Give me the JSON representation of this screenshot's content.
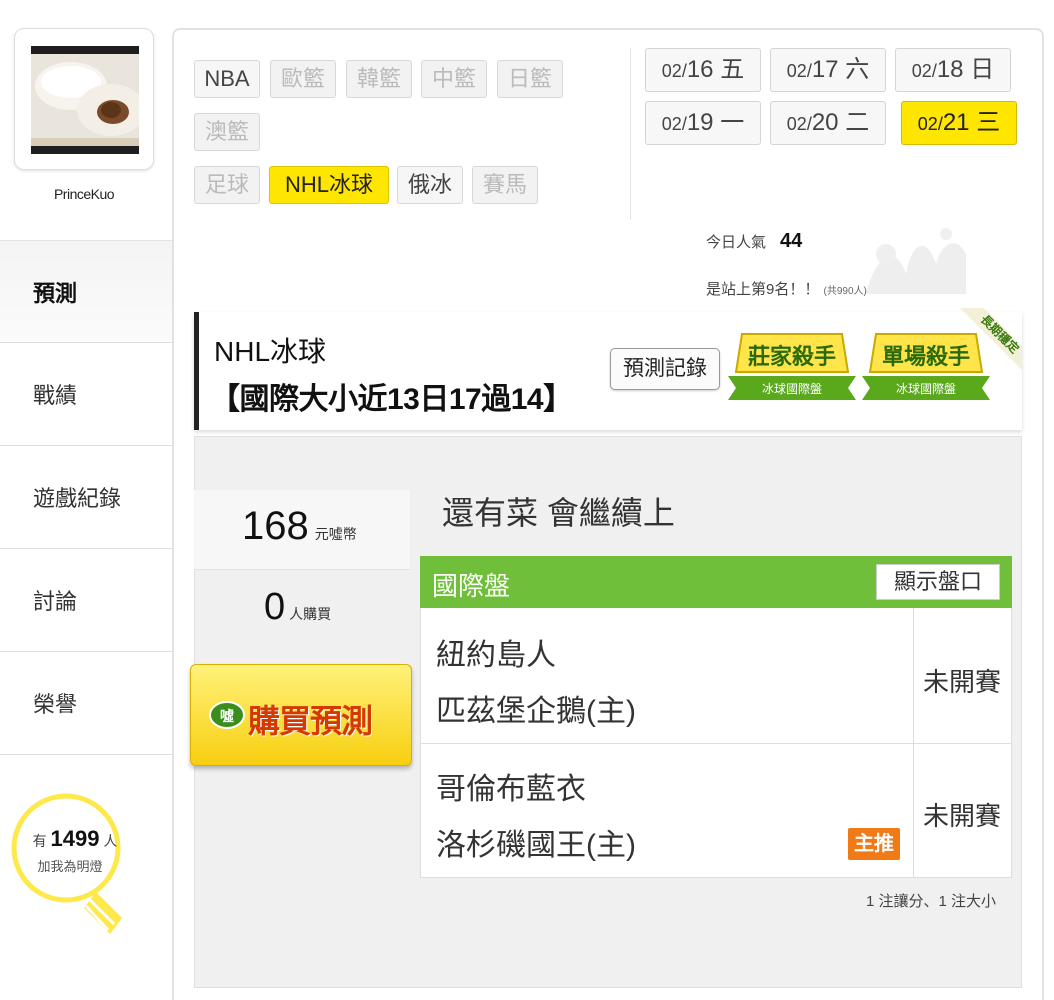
{
  "sidebar": {
    "username": "PrinceKuo",
    "items": [
      {
        "label": "預測",
        "active": true
      },
      {
        "label": "戰績"
      },
      {
        "label": "遊戲紀錄"
      },
      {
        "label": "討論"
      },
      {
        "label": "榮譽"
      }
    ],
    "fans": {
      "prefix": "有",
      "count": "1499",
      "suffix": "人",
      "label": "加我為明燈"
    }
  },
  "categories": [
    {
      "label": "NBA",
      "state": "enabled"
    },
    {
      "label": "歐籃",
      "state": "disabled"
    },
    {
      "label": "韓籃",
      "state": "disabled"
    },
    {
      "label": "中籃",
      "state": "disabled"
    },
    {
      "label": "日籃",
      "state": "disabled"
    },
    {
      "label": "澳籃",
      "state": "disabled"
    },
    {
      "label": "足球",
      "state": "disabled"
    },
    {
      "label": "NHL冰球",
      "state": "active"
    },
    {
      "label": "俄冰",
      "state": "enabled"
    },
    {
      "label": "賽馬",
      "state": "disabled"
    }
  ],
  "dates": [
    {
      "prefix": "02/",
      "day": "16",
      "weekday": "五"
    },
    {
      "prefix": "02/",
      "day": "17",
      "weekday": "六"
    },
    {
      "prefix": "02/",
      "day": "18",
      "weekday": "日"
    },
    {
      "prefix": "02/",
      "day": "19",
      "weekday": "一"
    },
    {
      "prefix": "02/",
      "day": "20",
      "weekday": "二"
    },
    {
      "prefix": "02/",
      "day": "21",
      "weekday": "三",
      "active": true
    }
  ],
  "stats": {
    "popularity_label": "今日人氣",
    "popularity_value": "44",
    "rank_text": "是站上第9名！！",
    "rank_total": "(共990人)"
  },
  "banner": {
    "title": "NHL冰球",
    "subtitle": "【國際大小近13日17過14】",
    "record_button": "預測記錄",
    "badges": [
      {
        "title": "莊家殺手",
        "sub": "冰球國際盤"
      },
      {
        "title": "單場殺手",
        "sub": "冰球國際盤"
      }
    ],
    "ribbon": "長期穩定"
  },
  "prediction": {
    "price_value": "168",
    "price_unit": "元噓幣",
    "buyers_value": "0",
    "buyers_unit": "人購買",
    "buy_button": "購買預測",
    "buy_icon_text": "噓",
    "headline": "還有菜 會繼續上"
  },
  "odds": {
    "title": "國際盤",
    "show_button": "顯示盤口",
    "games": [
      {
        "team1": "紐約島人",
        "team2": "匹茲堡企鵝(主)",
        "status": "未開賽"
      },
      {
        "team1": "哥倫布藍衣",
        "team2": "洛杉磯國王(主)",
        "status": "未開賽",
        "tag": "主推"
      }
    ],
    "summary": "1 注讓分、1 注大小"
  },
  "colors": {
    "accent_yellow": "#ffe600",
    "table_header_green": "#6fbf3a",
    "featured_orange": "#f07a17",
    "badge_green": "#5aa81c"
  },
  "icons": {
    "fan_bulb": "lightbulb-icon",
    "deco": "crown-deco-icon"
  }
}
